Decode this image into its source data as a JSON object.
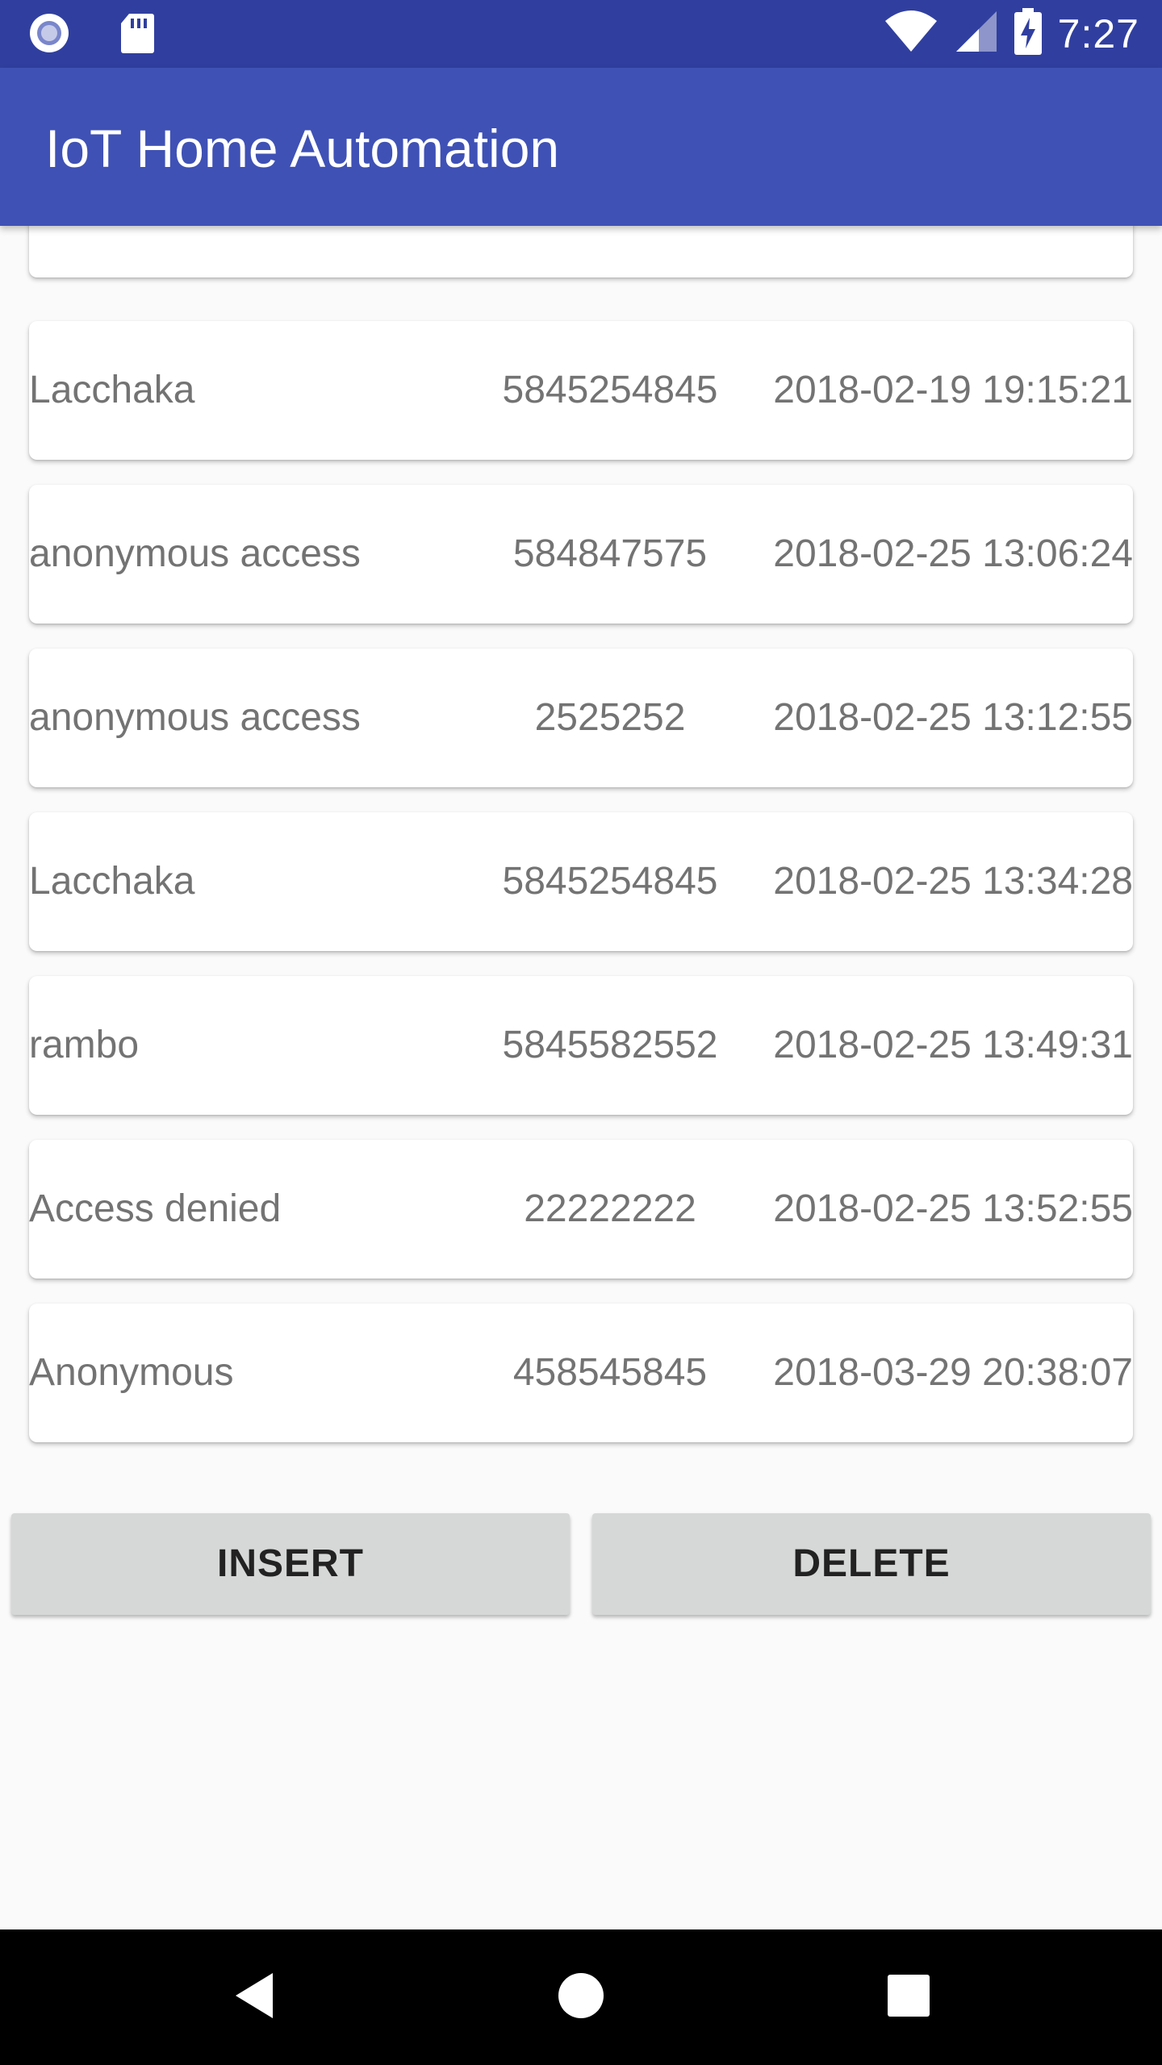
{
  "status_bar": {
    "time": "7:27",
    "icons": [
      "notification-circle-icon",
      "sd-card-icon",
      "wifi-icon",
      "cell-signal-icon",
      "battery-charging-icon"
    ]
  },
  "app_bar": {
    "title": "IoT Home Automation"
  },
  "records": [
    {
      "name": "",
      "code": "",
      "time": ""
    },
    {
      "name": "Lacchaka",
      "code": "5845254845",
      "time": "2018-02-19 19:15:21"
    },
    {
      "name": "anonymous access",
      "code": "584847575",
      "time": "2018-02-25 13:06:24"
    },
    {
      "name": "anonymous access",
      "code": "2525252",
      "time": "2018-02-25 13:12:55"
    },
    {
      "name": "Lacchaka",
      "code": "5845254845",
      "time": "2018-02-25 13:34:28"
    },
    {
      "name": "rambo",
      "code": "5845582552",
      "time": "2018-02-25 13:49:31"
    },
    {
      "name": "Access denied",
      "code": "22222222",
      "time": "2018-02-25 13:52:55"
    },
    {
      "name": "Anonymous",
      "code": "458545845",
      "time": "2018-03-29 20:38:07"
    }
  ],
  "buttons": {
    "insert": "INSERT",
    "delete": "DELETE"
  },
  "nav_bar": {
    "icons": [
      "back-icon",
      "home-icon",
      "recents-icon"
    ]
  },
  "colors": {
    "primary": "#3f51b5",
    "primary_dark": "#303f9f",
    "button": "#d6d7d7"
  }
}
